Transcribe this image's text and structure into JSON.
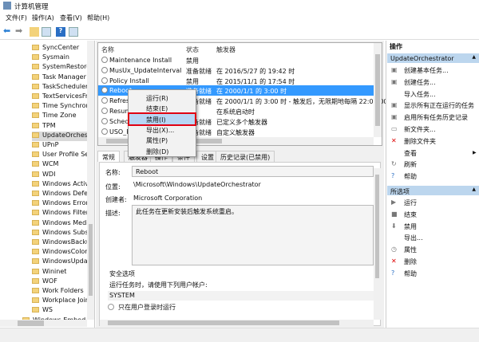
{
  "window": {
    "title": "计算机管理"
  },
  "menu": [
    "文件(F)",
    "操作(A)",
    "查看(V)",
    "帮助(H)"
  ],
  "tree": {
    "items": [
      "SyncCenter",
      "Sysmain",
      "SystemRestore",
      "Task Manager",
      "TaskScheduler",
      "TextServicesFra",
      "Time Synchron",
      "Time Zone",
      "TPM",
      "UpdateOrchest",
      "UPnP",
      "User Profile Se",
      "WCM",
      "WDI",
      "Windows Activ",
      "Windows Defe",
      "Windows Error",
      "Windows Filter",
      "Windows Medi",
      "Windows Subs",
      "WindowsBacku",
      "WindowsColor",
      "WindowsUpda",
      "Wininet",
      "WOF",
      "Work Folders",
      "Workplace Join",
      "WS"
    ],
    "selected": "UpdateOrchest",
    "parent_item": "Windows Embedd"
  },
  "tasks": {
    "headers": [
      "名称",
      "状态",
      "触发器"
    ],
    "rows": [
      {
        "name": "Maintenance Install",
        "status": "禁用",
        "trigger": ""
      },
      {
        "name": "MusUx_UpdateInterval",
        "status": "准备就绪",
        "trigger": "在 2016/5/27 的 19:42 时"
      },
      {
        "name": "Policy Install",
        "status": "禁用",
        "trigger": "在 2015/11/1 的 17:54 时"
      },
      {
        "name": "Reboot",
        "status": "准备就绪",
        "trigger": "在 2000/1/1 的 3:00 时"
      },
      {
        "name": "Refresh",
        "status": "准备就绪",
        "trigger": "在 2000/1/1 的 3:00 时 - 触发后，无限期地每隔 22:00:00 重"
      },
      {
        "name": "Resume",
        "status": "",
        "trigger": "在系统启动时"
      },
      {
        "name": "Schedu",
        "status": "准备就绪",
        "trigger": "已定义多个触发器"
      },
      {
        "name": "USO_R",
        "status": "准备就绪",
        "trigger": "自定义触发器"
      }
    ],
    "selected": "Reboot"
  },
  "context_menu": [
    "运行(R)",
    "结束(E)",
    "禁用(I)",
    "导出(X)...",
    "属性(P)",
    "删除(D)"
  ],
  "context_highlight": "禁用(I)",
  "detail": {
    "tabs": [
      "常规",
      "触发器",
      "操作",
      "条件",
      "设置",
      "历史记录(已禁用)"
    ],
    "name_label": "名称:",
    "name": "Reboot",
    "location_label": "位置:",
    "location": "\\Microsoft\\Windows\\UpdateOrchestrator",
    "author_label": "创建者:",
    "author": "Microsoft Corporation",
    "desc_label": "描述:",
    "desc": "此任务在更新安装后触发系统重启。",
    "security_title": "安全选项",
    "run_as_label": "运行任务时，请使用下列用户帐户:",
    "account": "SYSTEM",
    "radio1": "只在用户登录时运行"
  },
  "actions": {
    "header": "操作",
    "group1": "UpdateOrchestrator",
    "group1_items": [
      {
        "label": "创建基本任务...",
        "icon": "wizard-icon"
      },
      {
        "label": "创建任务...",
        "icon": "task-icon"
      },
      {
        "label": "导入任务...",
        "icon": ""
      },
      {
        "label": "显示所有正在运行的任务",
        "icon": "running-tasks-icon"
      },
      {
        "label": "启用所有任务历史记录",
        "icon": "history-icon"
      },
      {
        "label": "新文件夹...",
        "icon": "folder-icon"
      },
      {
        "label": "删除文件夹",
        "icon": "delete-x-icon"
      },
      {
        "label": "查看",
        "icon": ""
      },
      {
        "label": "刷新",
        "icon": "refresh-icon"
      },
      {
        "label": "帮助",
        "icon": "help-icon"
      }
    ],
    "group2": "所选项",
    "group2_items": [
      {
        "label": "运行",
        "icon": "run-icon"
      },
      {
        "label": "结束",
        "icon": "stop-icon"
      },
      {
        "label": "禁用",
        "icon": "disable-icon"
      },
      {
        "label": "导出...",
        "icon": ""
      },
      {
        "label": "属性",
        "icon": "properties-icon"
      },
      {
        "label": "删除",
        "icon": "delete-x-icon"
      },
      {
        "label": "帮助",
        "icon": "help-icon"
      }
    ]
  },
  "colors": {
    "selection": "#3399ff",
    "highlight_box": "#e00012",
    "group_header": "#bcd6ee"
  }
}
